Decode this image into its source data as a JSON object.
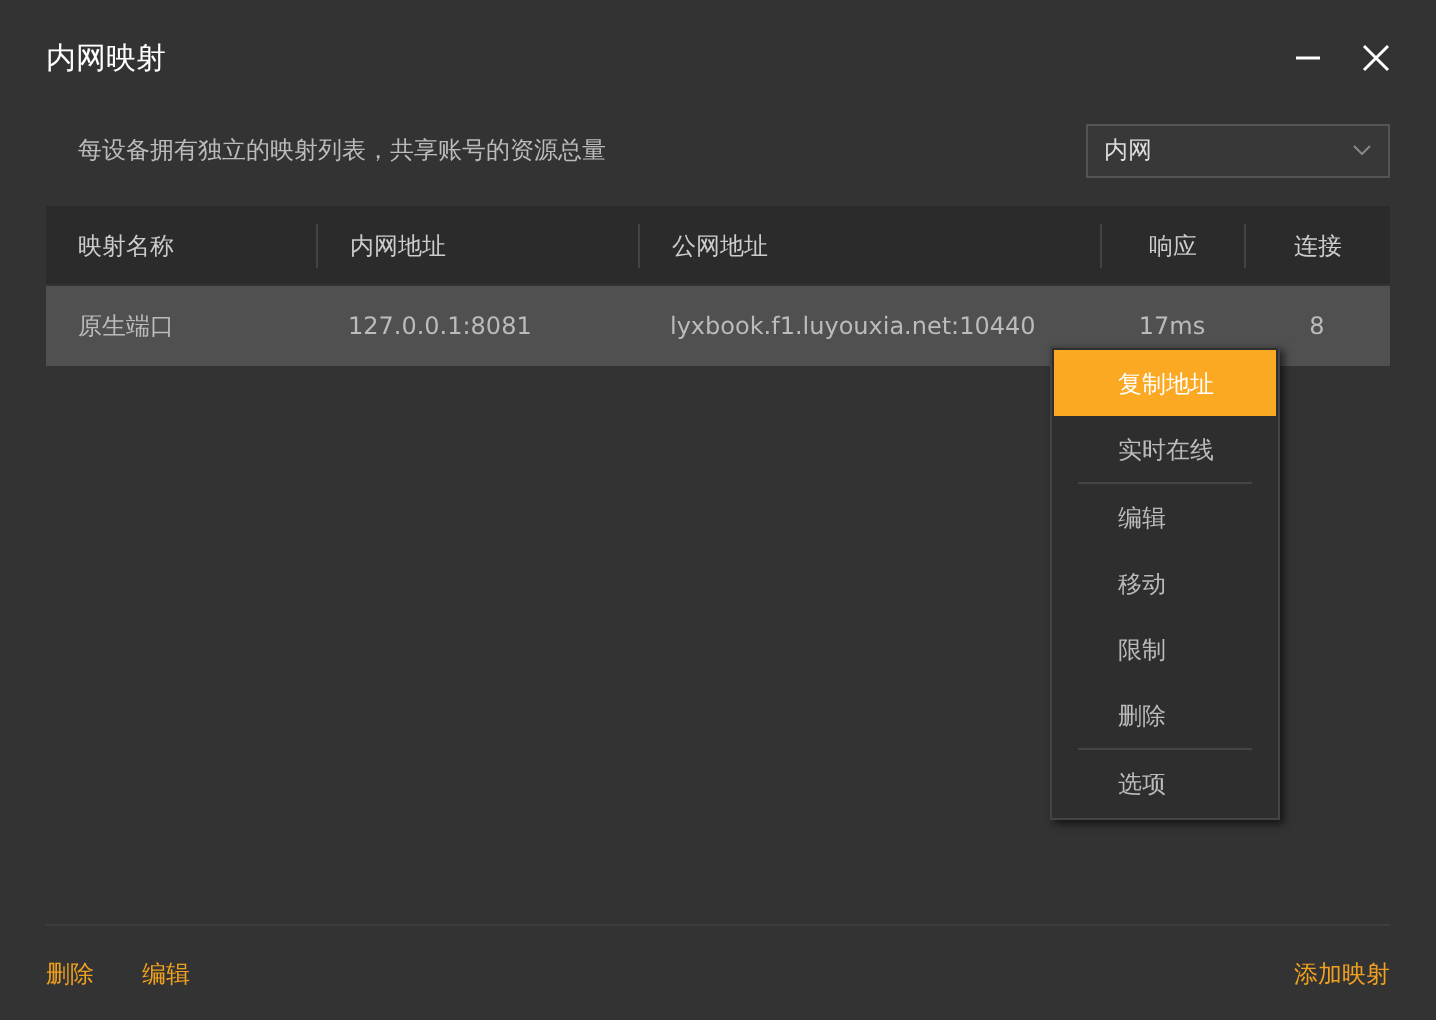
{
  "window": {
    "title": "内网映射"
  },
  "description": "每设备拥有独立的映射列表，共享账号的资源总量",
  "network_select": {
    "value": "内网"
  },
  "table": {
    "columns": [
      "映射名称",
      "内网地址",
      "公网地址",
      "响应",
      "连接"
    ],
    "rows": [
      {
        "selected": true,
        "cells": [
          "原生端口",
          "127.0.0.1:8081",
          "lyxbook.f1.luyouxia.net:10440",
          "17ms",
          "8"
        ]
      }
    ]
  },
  "context_menu": [
    {
      "kind": "item",
      "label": "复制地址",
      "selected": true
    },
    {
      "kind": "item",
      "label": "实时在线",
      "selected": false
    },
    {
      "kind": "separator"
    },
    {
      "kind": "item",
      "label": "编辑",
      "selected": false
    },
    {
      "kind": "item",
      "label": "移动",
      "selected": false
    },
    {
      "kind": "item",
      "label": "限制",
      "selected": false
    },
    {
      "kind": "item",
      "label": "删除",
      "selected": false
    },
    {
      "kind": "separator"
    },
    {
      "kind": "item",
      "label": "选项",
      "selected": false
    }
  ],
  "footer": {
    "left_links": [
      "删除",
      "编辑"
    ],
    "right_link": "添加映射"
  }
}
